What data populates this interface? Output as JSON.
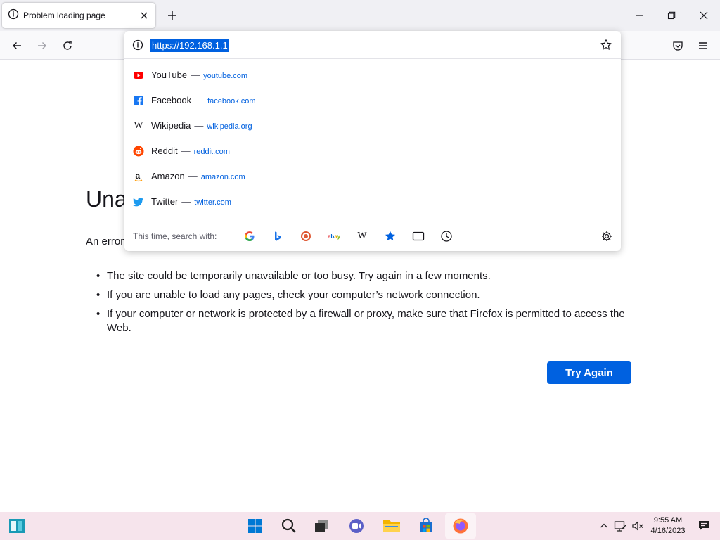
{
  "tab": {
    "title": "Problem loading page"
  },
  "urlbar": {
    "value": "https://192.168.1.1",
    "suggestions": [
      {
        "title": "YouTube",
        "url": "youtube.com",
        "icon": "youtube-icon",
        "color": "#ff0000"
      },
      {
        "title": "Facebook",
        "url": "facebook.com",
        "icon": "facebook-icon",
        "color": "#1877f2"
      },
      {
        "title": "Wikipedia",
        "url": "wikipedia.org",
        "icon": "wikipedia-icon",
        "color": "#111111"
      },
      {
        "title": "Reddit",
        "url": "reddit.com",
        "icon": "reddit-icon",
        "color": "#ff4500"
      },
      {
        "title": "Amazon",
        "url": "amazon.com",
        "icon": "amazon-icon",
        "color": "#111111"
      },
      {
        "title": "Twitter",
        "url": "twitter.com",
        "icon": "twitter-icon",
        "color": "#1d9bf0"
      }
    ],
    "search_label": "This time, search with:",
    "engines": [
      "google-icon",
      "bing-icon",
      "duckduckgo-icon",
      "ebay-icon",
      "wikipedia-icon",
      "bookmarks-icon",
      "tabs-icon",
      "history-icon"
    ]
  },
  "error": {
    "title": "Una",
    "lead": "An error",
    "items": [
      "The site could be temporarily unavailable or too busy. Try again in a few moments.",
      "If you are unable to load any pages, check your computer’s network connection.",
      "If your computer or network is protected by a firewall or proxy, make sure that Firefox is permitted to access the Web."
    ],
    "button": "Try Again"
  },
  "taskbar": {
    "time": "9:55 AM",
    "date": "4/16/2023"
  },
  "colors": {
    "accent": "#0061e0",
    "taskbar": "#f6e4ec",
    "tabstrip": "#f0f0f4"
  }
}
